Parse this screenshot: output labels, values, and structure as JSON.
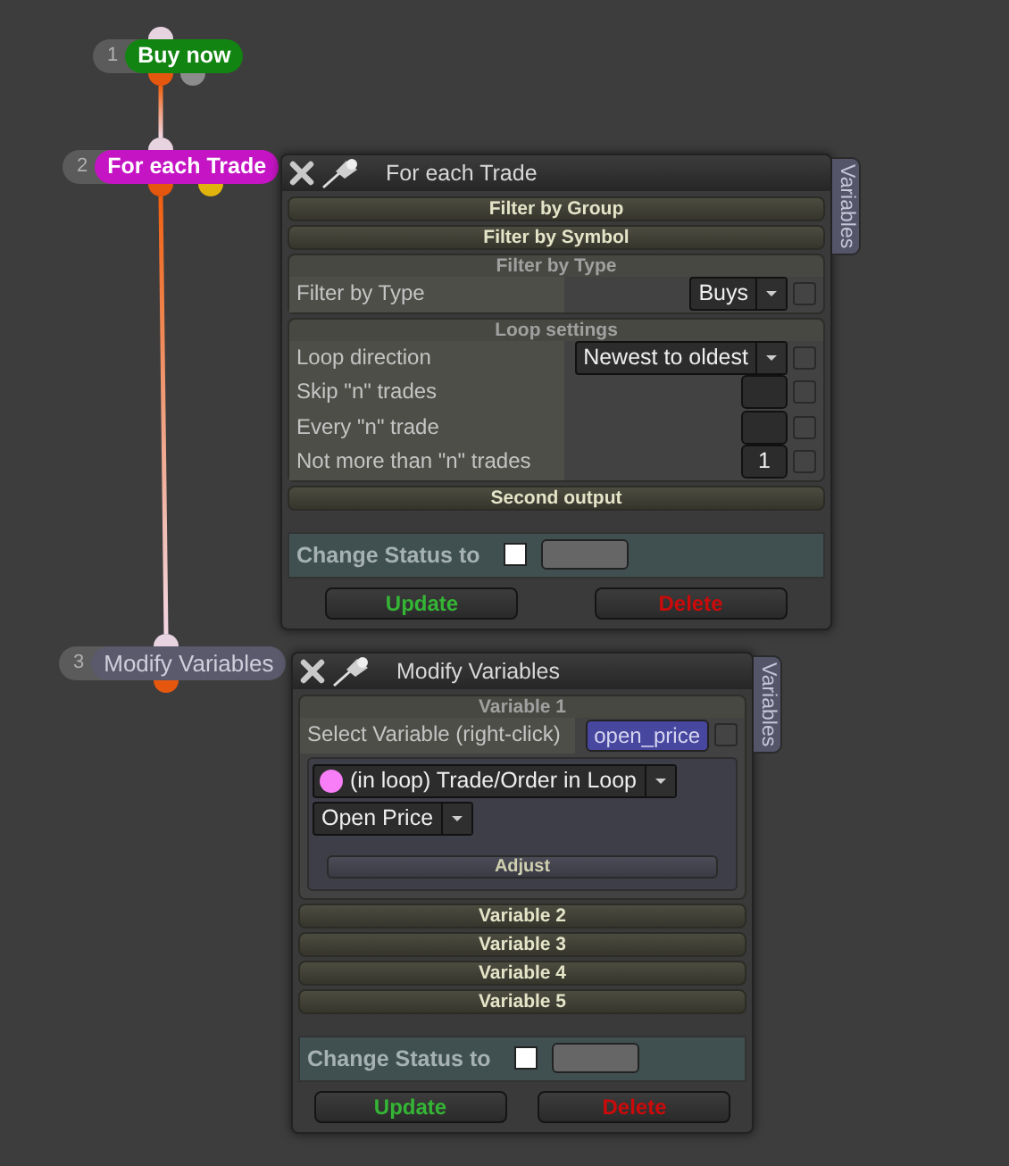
{
  "nodes": [
    {
      "number": "1",
      "label": "Buy now",
      "color": "#128412",
      "highlighted": true,
      "outputs": [
        {
          "color": "#e5570e"
        },
        {
          "color": "#8c8c8c"
        }
      ]
    },
    {
      "number": "2",
      "label": "For each Trade",
      "color": "#c414c4",
      "highlighted": true,
      "outputs": [
        {
          "color": "#e5570e"
        },
        {
          "color": "#e0b40c"
        }
      ]
    },
    {
      "number": "3",
      "label": "Modify Variables",
      "color": "#5a5a6c",
      "highlighted": false,
      "outputs": [
        {
          "color": "#e5570e"
        }
      ]
    }
  ],
  "windows": [
    {
      "title": "For each Trade",
      "side_tab": "Variables",
      "sections": [
        {
          "title": "Filter by Group",
          "expanded": false
        },
        {
          "title": "Filter by Symbol",
          "expanded": false
        },
        {
          "title": "Filter by Type",
          "expanded": true,
          "rows": [
            {
              "kind": "dropdown",
              "label": "Filter by Type",
              "value": "Buys",
              "checked": false
            }
          ]
        },
        {
          "title": "Loop settings",
          "expanded": true,
          "rows": [
            {
              "kind": "dropdown",
              "label": "Loop direction",
              "value": "Newest to oldest",
              "checked": false
            },
            {
              "kind": "number",
              "label": "Skip \"n\" trades",
              "checked": false
            },
            {
              "kind": "number",
              "label": "Every \"n\" trade",
              "checked": false
            },
            {
              "kind": "number",
              "label": "Not more than \"n\" trades",
              "value": "1",
              "checked": false
            }
          ]
        },
        {
          "title": "Second output",
          "expanded": false
        }
      ],
      "status_label": "Change Status to",
      "status_checked": false,
      "buttons": {
        "update": "Update",
        "delete": "Delete"
      }
    },
    {
      "title": "Modify Variables",
      "side_tab": "Variables",
      "sections": [
        {
          "title": "Variable 1",
          "expanded": true,
          "rows": [
            {
              "kind": "variable",
              "label": "Select Variable (right-click)",
              "value": "open_price",
              "checked": false
            },
            {
              "kind": "source",
              "source": {
                "label": "(in loop) Trade/Order in Loop",
                "color": "#f77ef7"
              },
              "field": "Open Price",
              "button": "Adjust"
            }
          ]
        },
        {
          "title": "Variable 2",
          "expanded": false
        },
        {
          "title": "Variable 3",
          "expanded": false
        },
        {
          "title": "Variable 4",
          "expanded": false
        },
        {
          "title": "Variable 5",
          "expanded": false
        }
      ],
      "status_label": "Change Status to",
      "status_checked": false,
      "buttons": {
        "update": "Update",
        "delete": "Delete"
      }
    }
  ]
}
